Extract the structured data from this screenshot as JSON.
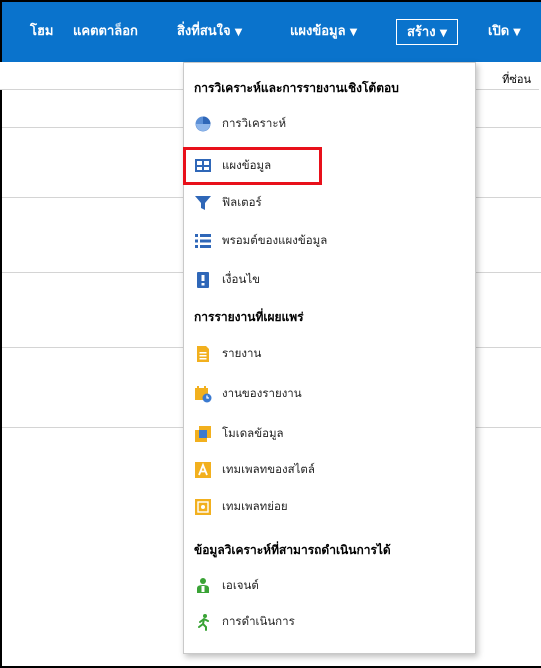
{
  "nav": {
    "home": "โฮม",
    "catalog": "แคตตาล็อก",
    "favorites": "สิ่งที่สนใจ",
    "dashboards": "แผงข้อมูล",
    "create": "สร้าง",
    "open": "เปิด",
    "caret": "▼"
  },
  "background": {
    "column_tail": "ที่ซ่อน"
  },
  "menu": {
    "section_interactive": "การวิเคราะห์และการรายงานเชิงโต้ตอบ",
    "section_published": "การรายงานที่เผยแพร่",
    "section_actionable": "ข้อมูลวิเคราะห์ที่สามารถดำเนินการได้",
    "items": [
      {
        "label": "การวิเคราะห์",
        "icon": "analysis-icon"
      },
      {
        "label": "แผงข้อมูล",
        "icon": "dashboard-icon"
      },
      {
        "label": "ฟิลเตอร์",
        "icon": "filter-icon"
      },
      {
        "label": "พรอมต์ของแผงข้อมูล",
        "icon": "dashboard-prompt-icon"
      },
      {
        "label": "เงื่อนไข",
        "icon": "condition-icon"
      },
      {
        "label": "รายงาน",
        "icon": "report-icon"
      },
      {
        "label": "งานของรายงาน",
        "icon": "report-job-icon"
      },
      {
        "label": "โมเดลข้อมูล",
        "icon": "data-model-icon"
      },
      {
        "label": "เทมเพลทของสไตล์",
        "icon": "style-template-icon"
      },
      {
        "label": "เทมเพลทย่อย",
        "icon": "sub-template-icon"
      },
      {
        "label": "เอเจนต์",
        "icon": "agent-icon"
      },
      {
        "label": "การดำเนินการ",
        "icon": "action-icon"
      }
    ]
  },
  "colors": {
    "topbar": "#0a73cc",
    "highlight": "#e8101a"
  }
}
